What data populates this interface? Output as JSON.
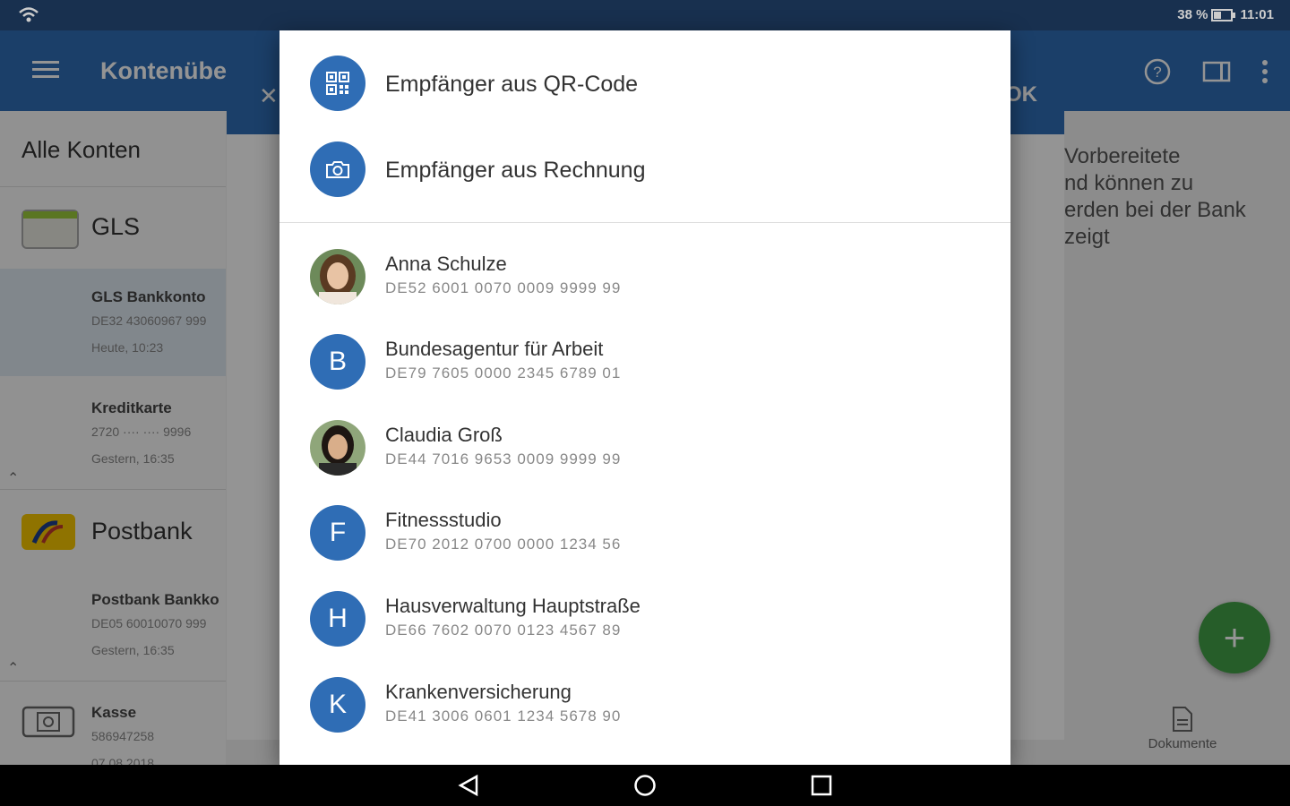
{
  "status": {
    "battery": "38 %",
    "time": "11:01"
  },
  "appbar": {
    "title": "Kontenübe",
    "help_icon": "help-circle-icon",
    "more_icon": "more-vert-icon"
  },
  "sidebar": {
    "header": "Alle Konten",
    "banks": [
      {
        "name": "GLS",
        "accounts": [
          {
            "name": "GLS Bankkonto",
            "iban": "DE32 43060967 999",
            "time": "Heute, 10:23"
          },
          {
            "name": "Kreditkarte",
            "iban": "2720 ···· ···· 9996",
            "time": "Gestern, 16:35"
          }
        ]
      },
      {
        "name": "Postbank",
        "accounts": [
          {
            "name": "Postbank Bankko",
            "iban": "DE05 60010070 999",
            "time": "Gestern, 16:35"
          }
        ]
      }
    ],
    "cash": {
      "name": "Kasse",
      "number": "586947258",
      "time": "07.08.2018"
    }
  },
  "middle": {
    "ok_label": "OK"
  },
  "right_panel": {
    "lines": [
      "Vorbereitete",
      "nd können zu",
      "erden bei der Bank",
      "zeigt"
    ]
  },
  "bottom": {
    "documents_label": "Dokumente"
  },
  "dialog": {
    "options": [
      {
        "label": "Empfänger aus QR-Code",
        "icon": "qr-code-icon"
      },
      {
        "label": "Empfänger aus Rechnung",
        "icon": "camera-icon"
      }
    ],
    "contacts": [
      {
        "name": "Anna Schulze",
        "iban": "DE52 6001 0070 0009 9999 99",
        "avatar": "photo"
      },
      {
        "name": "Bundesagentur für Arbeit",
        "iban": "DE79 7605 0000 2345 6789 01",
        "initial": "B"
      },
      {
        "name": "Claudia Groß",
        "iban": "DE44 7016 9653 0009 9999 99",
        "avatar": "photo"
      },
      {
        "name": "Fitnessstudio",
        "iban": "DE70 2012 0700 0000 1234 56",
        "initial": "F"
      },
      {
        "name": "Hausverwaltung Hauptstraße",
        "iban": "DE66 7602 0070 0123 4567 89",
        "initial": "H"
      },
      {
        "name": "Krankenversicherung",
        "iban": "DE41 3006 0601 1234 5678 90",
        "initial": "K"
      }
    ]
  },
  "colors": {
    "primary": "#2f6db5",
    "statusbar": "#1f3d63",
    "fab": "#43a047"
  }
}
